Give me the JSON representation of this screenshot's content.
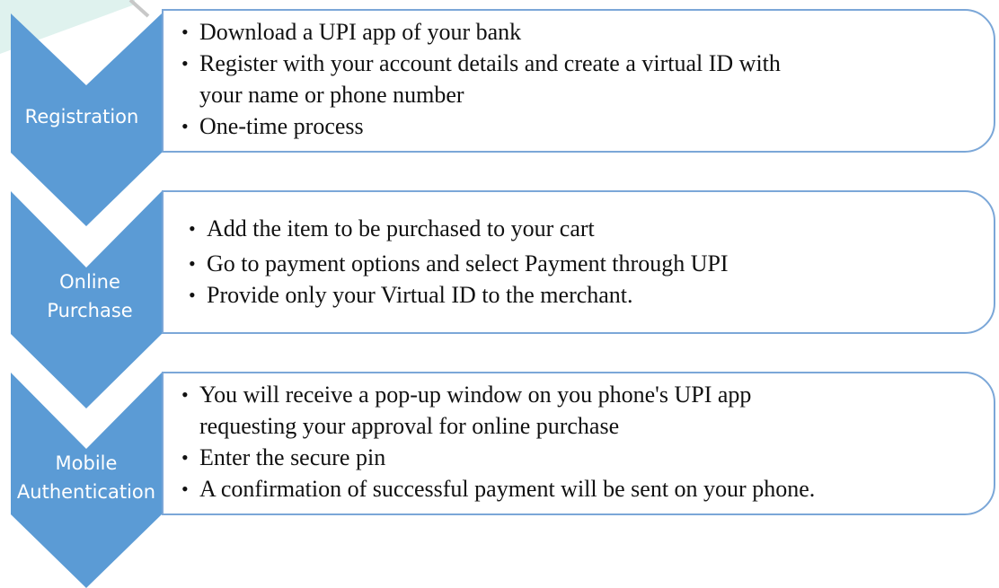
{
  "colors": {
    "chevron": "#5b9bd5",
    "panel_border": "#7ba7d8",
    "text": "#111111",
    "label_text": "#ffffff"
  },
  "stages": [
    {
      "label_lines": [
        "Registration"
      ],
      "bullets": [
        [
          "Download a UPI app  of your bank"
        ],
        [
          "Register with your account details and create a virtual ID with",
          "your name or phone number"
        ],
        [
          "One-time process"
        ]
      ]
    },
    {
      "label_lines": [
        "Online",
        "Purchase"
      ],
      "bullets": [
        [
          "Add the item to be purchased to your cart"
        ],
        [
          "Go to payment options and select Payment through UPI"
        ],
        [
          "Provide only your Virtual ID to the merchant."
        ]
      ]
    },
    {
      "label_lines": [
        "Mobile",
        "Authentication"
      ],
      "bullets": [
        [
          "You will receive a pop-up  window on you phone's UPI app",
          "requesting your approval for online purchase"
        ],
        [
          "Enter the secure pin"
        ],
        [
          "A confirmation of successful payment will be sent on your phone."
        ]
      ]
    }
  ]
}
